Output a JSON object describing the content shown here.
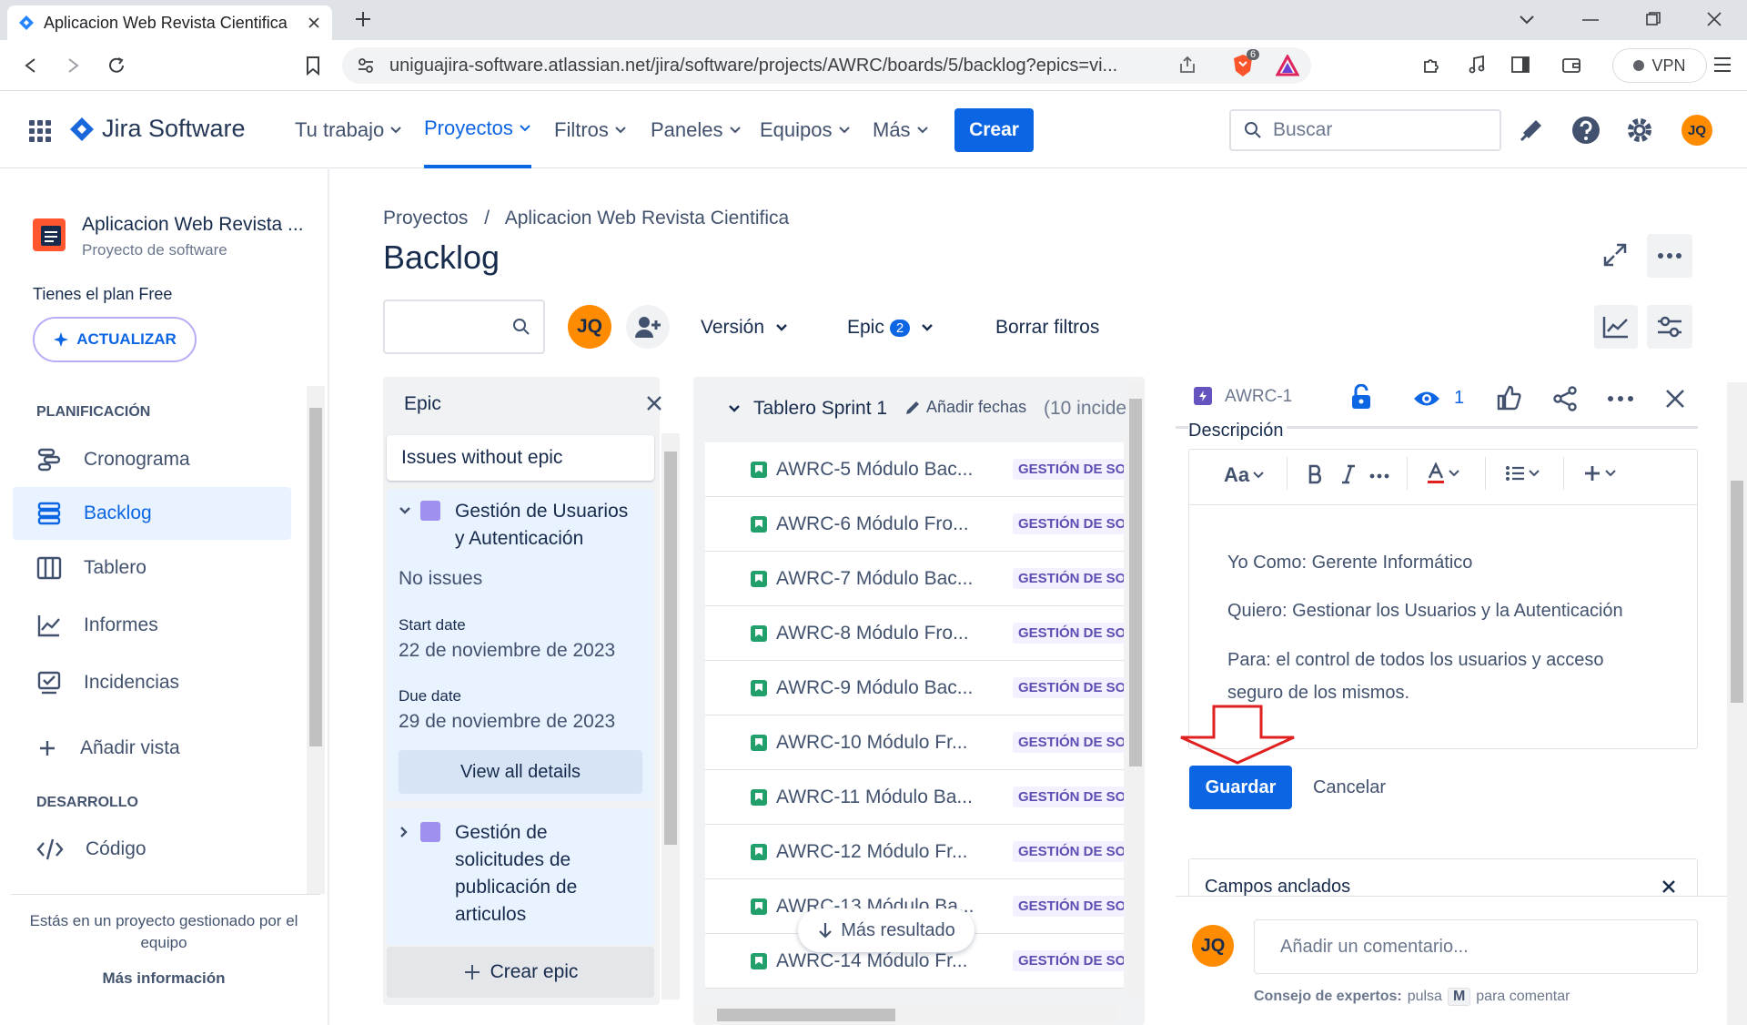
{
  "browser": {
    "tab_title": "Aplicacion Web Revista Cientifica",
    "url": "uniguajira-software.atlassian.net/jira/software/projects/AWRC/boards/5/backlog?epics=vi...",
    "brave_badge": "6",
    "vpn_label": "VPN"
  },
  "topnav": {
    "logo": "Jira Software",
    "items": [
      "Tu trabajo",
      "Proyectos",
      "Filtros",
      "Paneles",
      "Equipos",
      "Más"
    ],
    "create": "Crear",
    "search_placeholder": "Buscar",
    "avatar": "JQ"
  },
  "sidebar": {
    "project_name": "Aplicacion Web Revista ...",
    "project_type": "Proyecto de software",
    "plan": "Tienes el plan Free",
    "upgrade": "ACTUALIZAR",
    "planning_title": "PLANIFICACIÓN",
    "planning_items": [
      "Cronograma",
      "Backlog",
      "Tablero",
      "Informes",
      "Incidencias"
    ],
    "add_view": "Añadir vista",
    "dev_title": "DESARROLLO",
    "code": "Código",
    "footer_text": "Estás en un proyecto gestionado por el equipo",
    "footer_link": "Más información"
  },
  "main": {
    "breadcrumb_root": "Proyectos",
    "breadcrumb_sep": "/",
    "breadcrumb_project": "Aplicacion Web Revista Cientifica",
    "title": "Backlog",
    "avatar": "JQ",
    "version": "Versión",
    "epic": "Epic",
    "epic_count": "2",
    "clear_filters": "Borrar filtros"
  },
  "epic_panel": {
    "title": "Epic",
    "without": "Issues without epic",
    "epic1_name": "Gestión de Usuarios y Autenticación",
    "epic1_issues": "No issues",
    "start_label": "Start date",
    "start_value": "22 de noviembre de 2023",
    "due_label": "Due date",
    "due_value": "29 de noviembre de 2023",
    "view_details": "View all details",
    "epic2_name": "Gestión de solicitudes de publicación de articulos",
    "create_epic": "Crear epic"
  },
  "sprint": {
    "name": "Tablero Sprint 1",
    "add_dates": "Añadir fechas",
    "count": "(10 incide",
    "more_results": "Más resultado",
    "issues": [
      {
        "key": "AWRC-5 Módulo Bac...",
        "epic": "GESTIÓN DE SOLI"
      },
      {
        "key": "AWRC-6 Módulo Fro...",
        "epic": "GESTIÓN DE SOLI"
      },
      {
        "key": "AWRC-7 Módulo Bac...",
        "epic": "GESTIÓN DE SOLI"
      },
      {
        "key": "AWRC-8 Módulo Fro...",
        "epic": "GESTIÓN DE SOLI"
      },
      {
        "key": "AWRC-9 Módulo Bac...",
        "epic": "GESTIÓN DE SOLI"
      },
      {
        "key": "AWRC-10 Módulo Fr...",
        "epic": "GESTIÓN DE SOLI"
      },
      {
        "key": "AWRC-11 Módulo Ba...",
        "epic": "GESTIÓN DE SOLI"
      },
      {
        "key": "AWRC-12 Módulo Fr...",
        "epic": "GESTIÓN DE SOLI"
      },
      {
        "key": "AWRC-13 Módulo Ba...",
        "epic": "GESTIÓN DE SOLI"
      },
      {
        "key": "AWRC-14 Módulo Fr...",
        "epic": "GESTIÓN DE SOLI"
      }
    ]
  },
  "detail": {
    "key": "AWRC-1",
    "watchers": "1",
    "description_label": "Descripción",
    "text_style": "Aa",
    "line1": "Yo Como: Gerente Informático",
    "line2": "Quiero: Gestionar los Usuarios y la Autenticación",
    "line3a": "Para: el control de todos los usuarios y acceso",
    "line3b": "seguro de los mismos.",
    "save": "Guardar",
    "cancel": "Cancelar",
    "pinned": "Campos anclados",
    "comment_avatar": "JQ",
    "comment_placeholder": "Añadir un comentario...",
    "tip_bold": "Consejo de expertos:",
    "tip_rest1": "pulsa",
    "tip_key": "M",
    "tip_rest2": "para comentar"
  },
  "colors": {
    "accent": "#0c66e4",
    "avatar": "#ff8b00",
    "epic_purple": "#9f8fef",
    "annotation_arrow": "#e02020"
  }
}
